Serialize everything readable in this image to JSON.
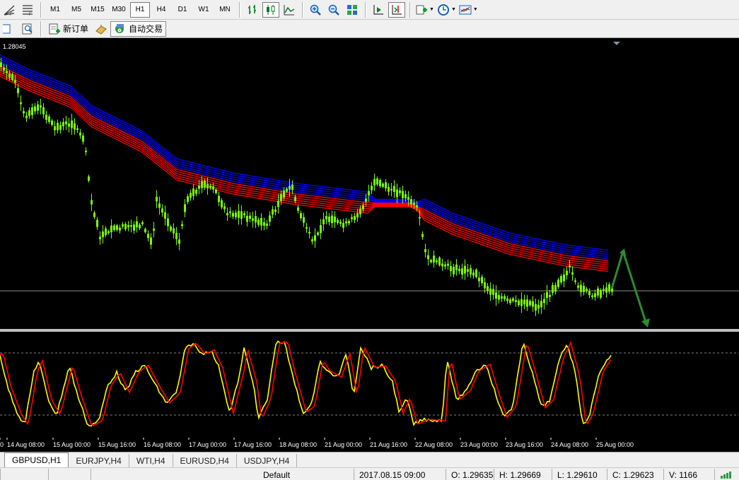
{
  "toolbar": {
    "timeframes": [
      "M1",
      "M5",
      "M15",
      "M30",
      "H1",
      "H4",
      "D1",
      "W1",
      "MN"
    ],
    "active_timeframe": "H1",
    "new_order_label": "新订单",
    "auto_trade_label": "自动交易"
  },
  "chart": {
    "price_label": "1.28045",
    "time_labels": [
      "0",
      "14 Aug 08:00",
      "15 Aug 00:00",
      "15 Aug 16:00",
      "16 Aug 08:00",
      "17 Aug 00:00",
      "17 Aug 16:00",
      "18 Aug 08:00",
      "21 Aug 00:00",
      "21 Aug 16:00",
      "22 Aug 08:00",
      "23 Aug 00:00",
      "23 Aug 16:00",
      "24 Aug 08:00",
      "25 Aug 00:00"
    ],
    "colors": {
      "background": "#000000",
      "candles": "#7cfc00",
      "ema_blue": "#0000ff",
      "ema_red": "#ff0000",
      "stoch_main": "#ffff00",
      "stoch_signal": "#ff0000",
      "arrow": "#2e8b2e"
    }
  },
  "tabs": [
    "GBPUSD,H1",
    "EURJPY,H4",
    "WTI,H4",
    "EURUSD,H4",
    "USDJPY,H4"
  ],
  "active_tab": "GBPUSD,H1",
  "status": {
    "profile": "Default",
    "datetime": "2017.08.15 09:00",
    "open": "O: 1.29635",
    "high": "H: 1.29669",
    "low": "L: 1.29610",
    "close": "C: 1.29623",
    "volume": "V: 1166"
  }
}
